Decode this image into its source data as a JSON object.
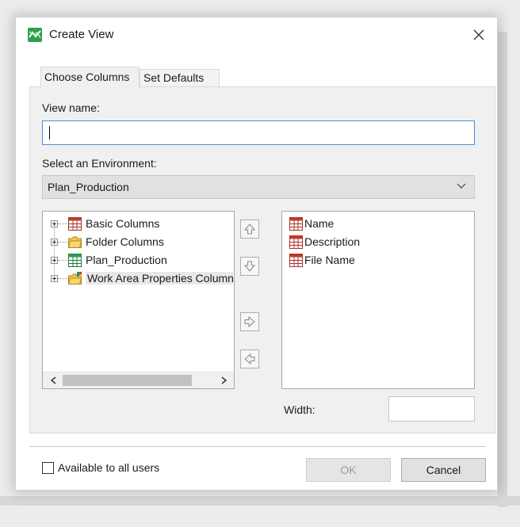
{
  "window": {
    "title": "Create View",
    "app_icon": "create-view-app-icon",
    "close_icon": "close-icon"
  },
  "tabs": [
    {
      "label": "Choose Columns",
      "active": true
    },
    {
      "label": "Set Defaults",
      "active": false
    }
  ],
  "form": {
    "view_name_label": "View name:",
    "view_name_value": "",
    "environment_label": "Select an Environment:",
    "environment_value": "Plan_Production"
  },
  "available_columns": [
    {
      "label": "Basic Columns",
      "icon": "table-icon"
    },
    {
      "label": "Folder Columns",
      "icon": "folder-icon"
    },
    {
      "label": "Plan_Production",
      "icon": "table-green-icon"
    },
    {
      "label": "Work Area Properties Columns",
      "icon": "work-area-folder-icon"
    }
  ],
  "selected_columns": [
    {
      "label": "Name",
      "icon": "table-icon"
    },
    {
      "label": "Description",
      "icon": "table-icon"
    },
    {
      "label": "File Name",
      "icon": "table-icon"
    }
  ],
  "width_label": "Width:",
  "available_to_all_users_label": "Available to all users",
  "available_to_all_users_checked": false,
  "buttons": {
    "ok": "OK",
    "cancel": "Cancel"
  },
  "colors": {
    "focus_border": "#4a8fd6",
    "table_red": "#c0392b",
    "folder_yellow": "#e8b923",
    "app_green": "#2e9e4f"
  }
}
